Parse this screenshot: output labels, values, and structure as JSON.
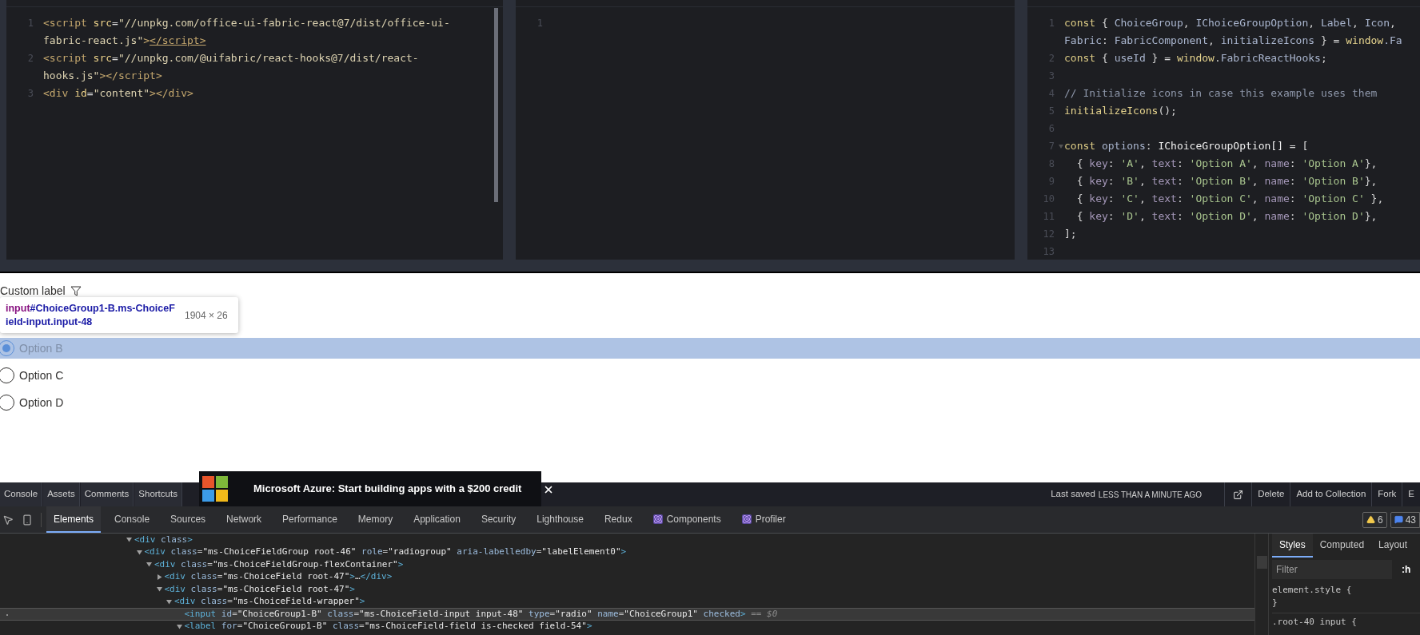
{
  "editors": [
    {
      "rows": [
        {
          "n": "1",
          "tokens": [
            {
              "text": "<script",
              "kind": "tag"
            },
            {
              "text": " src",
              "kind": "attr"
            },
            {
              "text": "=",
              "kind": "punct"
            },
            {
              "text": "\"//unpkg.com/office-ui-fabric-react@7/dist/office-ui-",
              "kind": "str"
            }
          ]
        },
        {
          "tokens": [
            {
              "text": "fabric-react.js\"",
              "kind": "str"
            },
            {
              "text": ">",
              "kind": "tag"
            },
            {
              "text": "</script>",
              "kind": "match"
            }
          ]
        },
        {
          "n": "2",
          "tokens": [
            {
              "text": "<script",
              "kind": "tag"
            },
            {
              "text": " src",
              "kind": "attr"
            },
            {
              "text": "=",
              "kind": "punct"
            },
            {
              "text": "\"//unpkg.com/@uifabric/react-hooks@7/dist/react-",
              "kind": "str"
            }
          ]
        },
        {
          "tokens": [
            {
              "text": "hooks.js\"",
              "kind": "str"
            },
            {
              "text": "></script>",
              "kind": "tag"
            }
          ]
        },
        {
          "n": "3",
          "tokens": [
            {
              "text": "<div",
              "kind": "tag"
            },
            {
              "text": " id",
              "kind": "attr"
            },
            {
              "text": "=",
              "kind": "punct"
            },
            {
              "text": "\"content\"",
              "kind": "str"
            },
            {
              "text": "></div>",
              "kind": "tag"
            }
          ]
        }
      ]
    },
    {
      "rows": [
        {
          "n": "1",
          "tokens": []
        }
      ]
    },
    {
      "rows": [
        {
          "n": "1",
          "fold": false,
          "tokens": [
            {
              "text": "const ",
              "kind": "kw"
            },
            {
              "text": "{ ",
              "kind": "punct"
            },
            {
              "text": "ChoiceGroup",
              "kind": "id"
            },
            {
              "text": ", ",
              "kind": "punct"
            },
            {
              "text": "IChoiceGroupOption",
              "kind": "id"
            },
            {
              "text": ", ",
              "kind": "punct"
            },
            {
              "text": "Label",
              "kind": "id"
            },
            {
              "text": ", ",
              "kind": "punct"
            },
            {
              "text": "Icon",
              "kind": "id"
            },
            {
              "text": ",",
              "kind": "punct"
            }
          ]
        },
        {
          "fold": false,
          "tokens": [
            {
              "text": "Fabric",
              "kind": "id"
            },
            {
              "text": ": ",
              "kind": "punct"
            },
            {
              "text": "FabricComponent",
              "kind": "id"
            },
            {
              "text": ", ",
              "kind": "punct"
            },
            {
              "text": "initializeIcons",
              "kind": "id"
            },
            {
              "text": " } = ",
              "kind": "punct"
            },
            {
              "text": "window",
              "kind": "fn"
            },
            {
              "text": ".Fa",
              "kind": "id"
            }
          ]
        },
        {
          "n": "2",
          "fold": false,
          "tokens": [
            {
              "text": "const ",
              "kind": "kw"
            },
            {
              "text": "{ ",
              "kind": "punct"
            },
            {
              "text": "useId",
              "kind": "id"
            },
            {
              "text": " } = ",
              "kind": "punct"
            },
            {
              "text": "window",
              "kind": "fn"
            },
            {
              "text": ".",
              "kind": "punct"
            },
            {
              "text": "FabricReactHooks",
              "kind": "id"
            },
            {
              "text": ";",
              "kind": "punct"
            }
          ]
        },
        {
          "n": "3",
          "fold": false,
          "tokens": []
        },
        {
          "n": "4",
          "fold": false,
          "tokens": [
            {
              "text": "// Initialize icons in case this example uses them",
              "kind": "comment"
            }
          ]
        },
        {
          "n": "5",
          "fold": false,
          "tokens": [
            {
              "text": "initializeIcons",
              "kind": "fn"
            },
            {
              "text": "();",
              "kind": "punct"
            }
          ]
        },
        {
          "n": "6",
          "fold": false,
          "tokens": []
        },
        {
          "n": "7",
          "fold": true,
          "tokens": [
            {
              "text": "const ",
              "kind": "kw"
            },
            {
              "text": "options",
              "kind": "id"
            },
            {
              "text": ": ",
              "kind": "punct"
            },
            {
              "text": "IChoiceGroupOption[]",
              "kind": "type"
            },
            {
              "text": " = [",
              "kind": "punct"
            }
          ]
        },
        {
          "n": "8",
          "fold": false,
          "tokens": [
            {
              "text": "  { ",
              "kind": "punct"
            },
            {
              "text": "key",
              "kind": "prop"
            },
            {
              "text": ": ",
              "kind": "punct"
            },
            {
              "text": "'A'",
              "kind": "str"
            },
            {
              "text": ", ",
              "kind": "punct"
            },
            {
              "text": "text",
              "kind": "prop"
            },
            {
              "text": ": ",
              "kind": "punct"
            },
            {
              "text": "'Option A'",
              "kind": "str"
            },
            {
              "text": ", ",
              "kind": "punct"
            },
            {
              "text": "name",
              "kind": "prop"
            },
            {
              "text": ": ",
              "kind": "punct"
            },
            {
              "text": "'Option A'",
              "kind": "str"
            },
            {
              "text": "},",
              "kind": "punct"
            }
          ]
        },
        {
          "n": "9",
          "fold": false,
          "tokens": [
            {
              "text": "  { ",
              "kind": "punct"
            },
            {
              "text": "key",
              "kind": "prop"
            },
            {
              "text": ": ",
              "kind": "punct"
            },
            {
              "text": "'B'",
              "kind": "str"
            },
            {
              "text": ", ",
              "kind": "punct"
            },
            {
              "text": "text",
              "kind": "prop"
            },
            {
              "text": ": ",
              "kind": "punct"
            },
            {
              "text": "'Option B'",
              "kind": "str"
            },
            {
              "text": ", ",
              "kind": "punct"
            },
            {
              "text": "name",
              "kind": "prop"
            },
            {
              "text": ": ",
              "kind": "punct"
            },
            {
              "text": "'Option B'",
              "kind": "str"
            },
            {
              "text": "},",
              "kind": "punct"
            }
          ]
        },
        {
          "n": "10",
          "fold": false,
          "tokens": [
            {
              "text": "  { ",
              "kind": "punct"
            },
            {
              "text": "key",
              "kind": "prop"
            },
            {
              "text": ": ",
              "kind": "punct"
            },
            {
              "text": "'C'",
              "kind": "str"
            },
            {
              "text": ", ",
              "kind": "punct"
            },
            {
              "text": "text",
              "kind": "prop"
            },
            {
              "text": ": ",
              "kind": "punct"
            },
            {
              "text": "'Option C'",
              "kind": "str"
            },
            {
              "text": ", ",
              "kind": "punct"
            },
            {
              "text": "name",
              "kind": "prop"
            },
            {
              "text": ": ",
              "kind": "punct"
            },
            {
              "text": "'Option C'",
              "kind": "str"
            },
            {
              "text": " },",
              "kind": "punct"
            }
          ]
        },
        {
          "n": "11",
          "fold": false,
          "tokens": [
            {
              "text": "  { ",
              "kind": "punct"
            },
            {
              "text": "key",
              "kind": "prop"
            },
            {
              "text": ": ",
              "kind": "punct"
            },
            {
              "text": "'D'",
              "kind": "str"
            },
            {
              "text": ", ",
              "kind": "punct"
            },
            {
              "text": "text",
              "kind": "prop"
            },
            {
              "text": ": ",
              "kind": "punct"
            },
            {
              "text": "'Option D'",
              "kind": "str"
            },
            {
              "text": ", ",
              "kind": "punct"
            },
            {
              "text": "name",
              "kind": "prop"
            },
            {
              "text": ": ",
              "kind": "punct"
            },
            {
              "text": "'Option D'",
              "kind": "str"
            },
            {
              "text": "},",
              "kind": "punct"
            }
          ]
        },
        {
          "n": "12",
          "fold": false,
          "tokens": [
            {
              "text": "];",
              "kind": "punct"
            }
          ]
        },
        {
          "n": "13",
          "fold": false,
          "tokens": []
        }
      ]
    }
  ],
  "preview": {
    "label": "Custom label",
    "options": [
      {
        "text": "Option B",
        "selected": true,
        "highlighted": true
      },
      {
        "text": "Option C",
        "selected": false,
        "highlighted": false
      },
      {
        "text": "Option D",
        "selected": false,
        "highlighted": false
      }
    ],
    "inspect_tooltip": {
      "tag": "input",
      "selector": "#ChoiceGroup1-B.ms-ChoiceField-input.input-48",
      "size": "1904 × 26"
    }
  },
  "codepen_bar": {
    "buttons": [
      "Console",
      "Assets",
      "Comments",
      "Shortcuts"
    ],
    "ad": {
      "text": "Microsoft Azure: Start building apps with a $200 credit"
    },
    "saved_label": "Last saved",
    "saved_time": "LESS THAN A MINUTE AGO",
    "actions": [
      "Delete",
      "Add to Collection",
      "Fork",
      "E"
    ]
  },
  "devtools": {
    "tabs": [
      {
        "label": "Elements",
        "selected": true,
        "kind": "plain"
      },
      {
        "label": "Console",
        "selected": false,
        "kind": "plain"
      },
      {
        "label": "Sources",
        "selected": false,
        "kind": "plain"
      },
      {
        "label": "Network",
        "selected": false,
        "kind": "plain"
      },
      {
        "label": "Performance",
        "selected": false,
        "kind": "plain"
      },
      {
        "label": "Memory",
        "selected": false,
        "kind": "plain"
      },
      {
        "label": "Application",
        "selected": false,
        "kind": "plain"
      },
      {
        "label": "Security",
        "selected": false,
        "kind": "plain"
      },
      {
        "label": "Lighthouse",
        "selected": false,
        "kind": "plain"
      },
      {
        "label": "Redux",
        "selected": false,
        "kind": "plain"
      },
      {
        "label": "Components",
        "selected": false,
        "kind": "react"
      },
      {
        "label": "Profiler",
        "selected": false,
        "kind": "react"
      }
    ],
    "warnings": "6",
    "messages": "43",
    "tree": [
      {
        "expanded": true,
        "selected": false,
        "tokens": [
          {
            "text": "<div",
            "kind": "tag"
          },
          {
            "text": " class",
            "kind": "attr"
          },
          {
            "text": ">",
            "kind": "tag"
          }
        ],
        "children": [
          {
            "expanded": true,
            "selected": false,
            "tokens": [
              {
                "text": "<div",
                "kind": "tag"
              },
              {
                "text": " class",
                "kind": "attr"
              },
              {
                "text": "=",
                "kind": "punct"
              },
              {
                "text": "\"ms-ChoiceFieldGroup root-46\"",
                "kind": "value"
              },
              {
                "text": " role",
                "kind": "attr"
              },
              {
                "text": "=",
                "kind": "punct"
              },
              {
                "text": "\"radiogroup\"",
                "kind": "value"
              },
              {
                "text": " aria-labelledby",
                "kind": "attr"
              },
              {
                "text": "=",
                "kind": "punct"
              },
              {
                "text": "\"labelElement0\"",
                "kind": "value"
              },
              {
                "text": ">",
                "kind": "tag"
              }
            ],
            "children": [
              {
                "expanded": true,
                "selected": false,
                "tokens": [
                  {
                    "text": "<div",
                    "kind": "tag"
                  },
                  {
                    "text": " class",
                    "kind": "attr"
                  },
                  {
                    "text": "=",
                    "kind": "punct"
                  },
                  {
                    "text": "\"ms-ChoiceFieldGroup-flexContainer\"",
                    "kind": "value"
                  },
                  {
                    "text": ">",
                    "kind": "tag"
                  }
                ],
                "children": [
                  {
                    "expanded": false,
                    "selected": false,
                    "tokens": [
                      {
                        "text": "<div",
                        "kind": "tag"
                      },
                      {
                        "text": " class",
                        "kind": "attr"
                      },
                      {
                        "text": "=",
                        "kind": "punct"
                      },
                      {
                        "text": "\"ms-ChoiceField root-47\"",
                        "kind": "value"
                      },
                      {
                        "text": ">",
                        "kind": "tag"
                      },
                      {
                        "text": "…",
                        "kind": "value"
                      },
                      {
                        "text": "</div>",
                        "kind": "tag"
                      }
                    ]
                  },
                  {
                    "expanded": true,
                    "selected": false,
                    "tokens": [
                      {
                        "text": "<div",
                        "kind": "tag"
                      },
                      {
                        "text": " class",
                        "kind": "attr"
                      },
                      {
                        "text": "=",
                        "kind": "punct"
                      },
                      {
                        "text": "\"ms-ChoiceField root-47\"",
                        "kind": "value"
                      },
                      {
                        "text": ">",
                        "kind": "tag"
                      }
                    ],
                    "children": [
                      {
                        "expanded": true,
                        "selected": false,
                        "tokens": [
                          {
                            "text": "<div",
                            "kind": "tag"
                          },
                          {
                            "text": " class",
                            "kind": "attr"
                          },
                          {
                            "text": "=",
                            "kind": "punct"
                          },
                          {
                            "text": "\"ms-ChoiceField-wrapper\"",
                            "kind": "value"
                          },
                          {
                            "text": ">",
                            "kind": "tag"
                          }
                        ],
                        "children": [
                          {
                            "selected": true,
                            "tokens": [
                              {
                                "text": "<input",
                                "kind": "tag"
                              },
                              {
                                "text": " id",
                                "kind": "attr"
                              },
                              {
                                "text": "=",
                                "kind": "punct"
                              },
                              {
                                "text": "\"ChoiceGroup1-B\"",
                                "kind": "value"
                              },
                              {
                                "text": " class",
                                "kind": "attr"
                              },
                              {
                                "text": "=",
                                "kind": "punct"
                              },
                              {
                                "text": "\"ms-ChoiceField-input input-48\"",
                                "kind": "value"
                              },
                              {
                                "text": " type",
                                "kind": "attr"
                              },
                              {
                                "text": "=",
                                "kind": "punct"
                              },
                              {
                                "text": "\"radio\"",
                                "kind": "value"
                              },
                              {
                                "text": " name",
                                "kind": "attr"
                              },
                              {
                                "text": "=",
                                "kind": "punct"
                              },
                              {
                                "text": "\"ChoiceGroup1\"",
                                "kind": "value"
                              },
                              {
                                "text": " checked",
                                "kind": "attr"
                              },
                              {
                                "text": ">",
                                "kind": "tag"
                              },
                              {
                                "text": " == $0",
                                "kind": "ref"
                              }
                            ]
                          },
                          {
                            "expanded": true,
                            "selected": false,
                            "tokens": [
                              {
                                "text": "<label",
                                "kind": "tag"
                              },
                              {
                                "text": " for",
                                "kind": "attr"
                              },
                              {
                                "text": "=",
                                "kind": "punct"
                              },
                              {
                                "text": "\"ChoiceGroup1-B\"",
                                "kind": "value"
                              },
                              {
                                "text": " class",
                                "kind": "attr"
                              },
                              {
                                "text": "=",
                                "kind": "punct"
                              },
                              {
                                "text": "\"ms-ChoiceField-field is-checked field-54\"",
                                "kind": "value"
                              },
                              {
                                "text": ">",
                                "kind": "tag"
                              }
                            ]
                          }
                        ]
                      }
                    ]
                  }
                ]
              }
            ]
          }
        ]
      }
    ],
    "styles": {
      "tabs": [
        {
          "label": "Styles",
          "selected": true
        },
        {
          "label": "Computed",
          "selected": false
        },
        {
          "label": "Layout",
          "selected": false
        }
      ],
      "filter_placeholder": "Filter",
      "filter_toggle": ":h",
      "rules": [
        "element.style {",
        "}",
        ".root-40 input {"
      ]
    }
  }
}
